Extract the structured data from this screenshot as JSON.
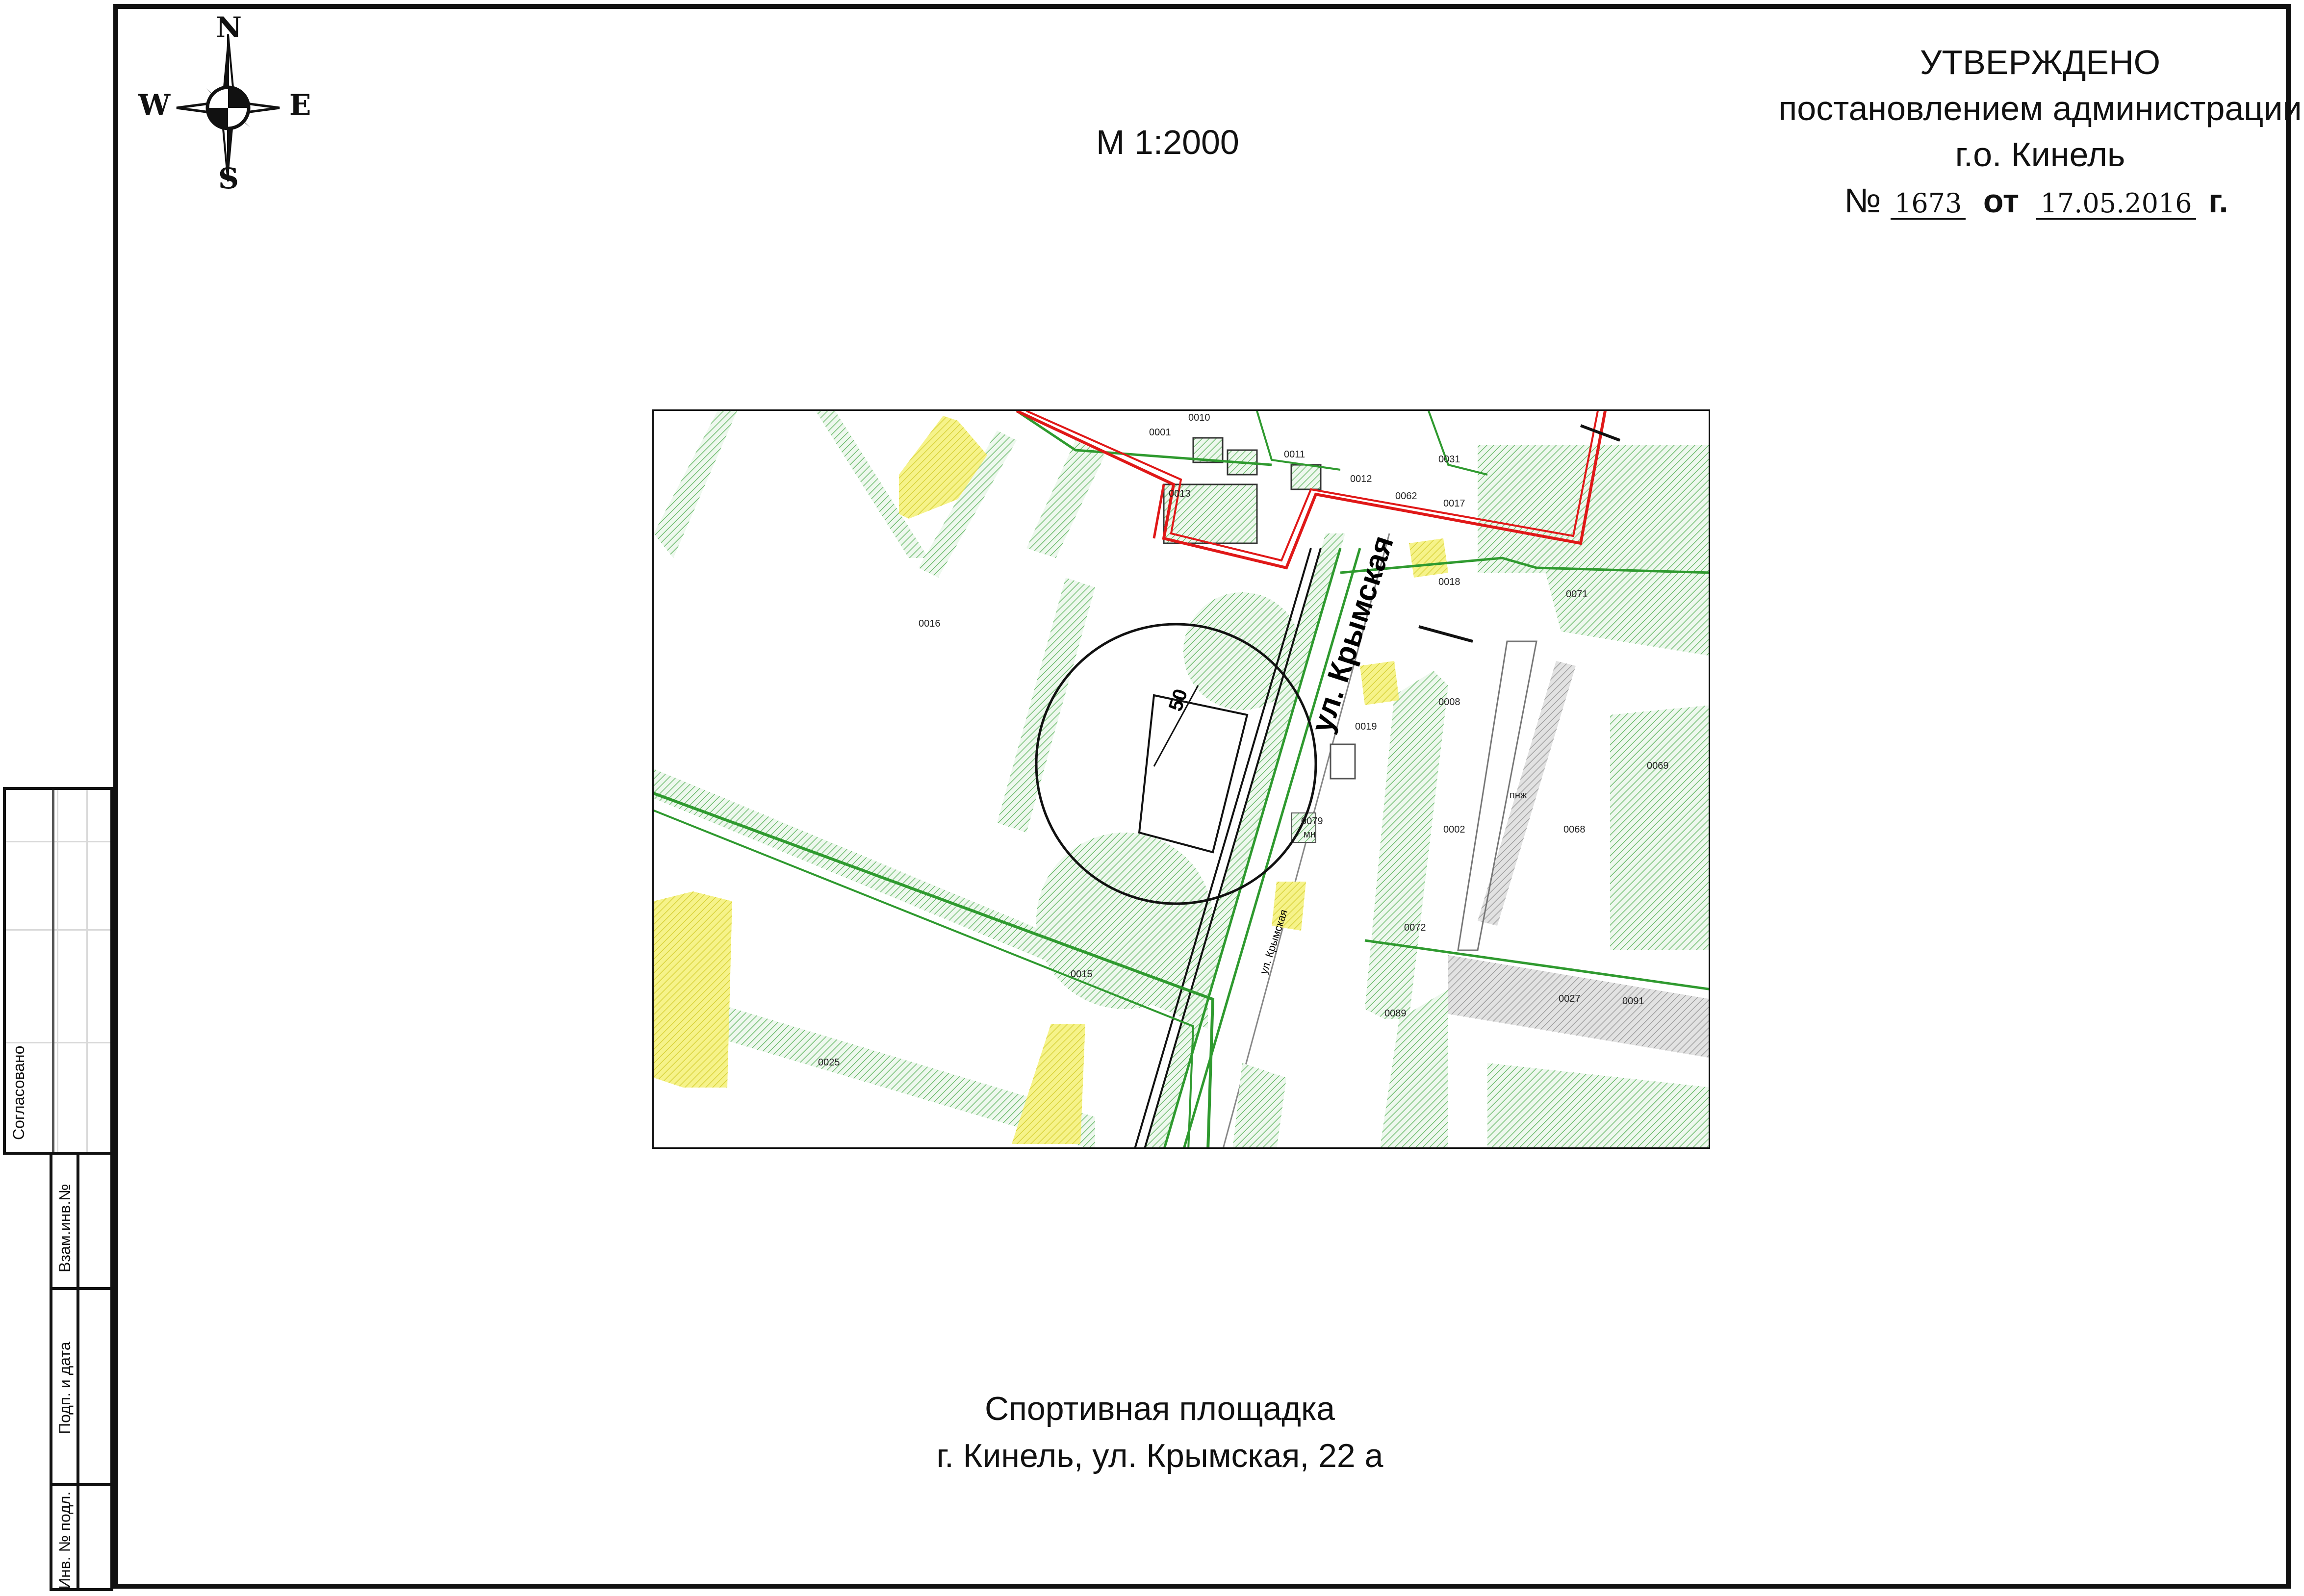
{
  "compass": {
    "n": "N",
    "s": "S",
    "e": "E",
    "w": "W"
  },
  "scale": "М 1:2000",
  "approval": {
    "title": "УТВЕРЖДЕНО",
    "line1": "постановлением администрации",
    "line2": "г.о. Кинель",
    "number_prefix": "№",
    "number": "1673",
    "from_label": "от",
    "date": "17.05.2016",
    "year_suffix": "г."
  },
  "side_block": {
    "agreed": "Согласовано",
    "exchange_inv": "Взам.инв.№",
    "sign_date": "Подп. и дата",
    "inv_orig": "Инв. № подл."
  },
  "map": {
    "street_label": "ул. Крымская",
    "street_label_small": "ул. Крымская",
    "radius_label": "50",
    "parcels": [
      "0001",
      "0010",
      "0011",
      "0012",
      "0031",
      "0013",
      "0062",
      "0017",
      "0018",
      "0071",
      "0016",
      "0019",
      "0008",
      "0069",
      "0068",
      "0079",
      "мн",
      "0072",
      "0015",
      "0089",
      "0027",
      "0091",
      "0025",
      "0002",
      "пнж"
    ],
    "colors": {
      "green": "#2f9a2f",
      "hatch": "#7cc47c",
      "red": "#e01818",
      "yellow": "#f3ef5a",
      "grey": "#bdbdbd"
    }
  },
  "caption": {
    "line1": "Спортивная площадка",
    "line2": "г. Кинель,  ул. Крымская, 22 а"
  }
}
